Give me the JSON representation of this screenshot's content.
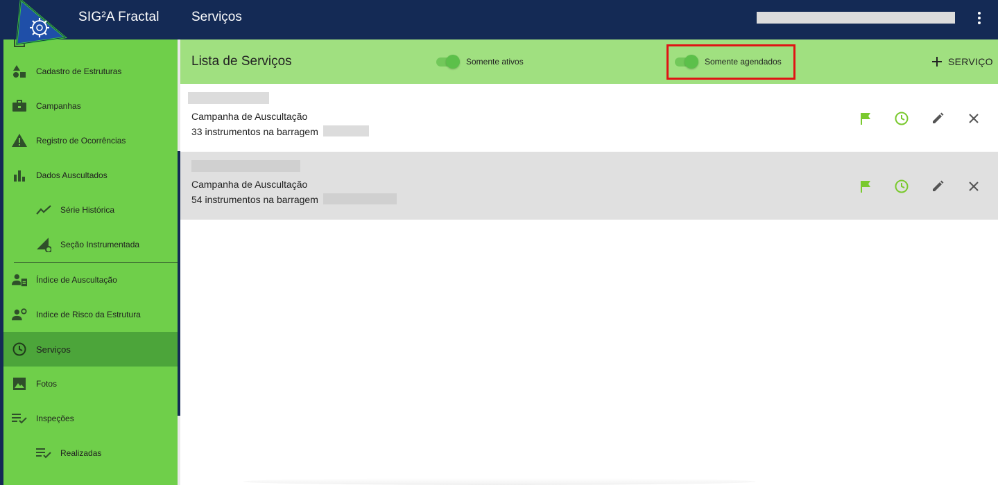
{
  "app": {
    "title": "SIG²A Fractal",
    "page_title": "Serviços"
  },
  "colors": {
    "topbar": "#142a55",
    "sidebar": "#6fcf4a",
    "sidebar_active": "#4ca53a",
    "header": "#a0e080",
    "accent_green": "#7ac92e",
    "highlight": "#e01414"
  },
  "sidebar": {
    "items": [
      {
        "label": "Cadastro de Estruturas",
        "icon": "shapes-icon"
      },
      {
        "label": "Campanhas",
        "icon": "briefcase-icon"
      },
      {
        "label": "Registro de Ocorrências",
        "icon": "warning-icon"
      },
      {
        "label": "Dados Auscultados",
        "icon": "bar-chart-icon"
      },
      {
        "label": "Série Histórica",
        "icon": "line-chart-icon"
      },
      {
        "label": "Seção Instrumentada",
        "icon": "section-gear-icon"
      },
      {
        "label": "Índice de Auscultação",
        "icon": "worker-badge-icon"
      },
      {
        "label": "Indice de Risco da Estrutura",
        "icon": "worker-gear-icon"
      },
      {
        "label": "Serviços",
        "icon": "clock-icon"
      },
      {
        "label": "Fotos",
        "icon": "image-icon"
      },
      {
        "label": "Inspeções",
        "icon": "checklist-icon"
      },
      {
        "label": "Realizadas",
        "icon": "checklist-icon"
      }
    ]
  },
  "header": {
    "list_title": "Lista de Serviços",
    "toggle_active_label": "Somente ativos",
    "toggle_scheduled_label": "Somente agendados",
    "add_service_label": "SERVIÇO"
  },
  "services": [
    {
      "type": "Campanha de Auscultação",
      "instruments": "33 instrumentos na barragem"
    },
    {
      "type": "Campanha de Auscultação",
      "instruments": "54 instrumentos na barragem"
    }
  ]
}
